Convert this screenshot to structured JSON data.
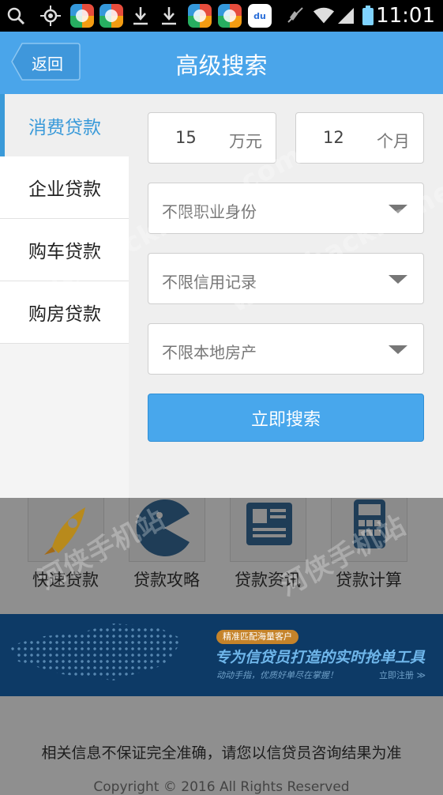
{
  "status_bar": {
    "time": "11:01",
    "icons": [
      "search-icon",
      "locate-icon",
      "app-icon",
      "app-icon",
      "download-icon",
      "download-icon",
      "app-icon",
      "app-icon",
      "baidu-icon",
      "mute-icon",
      "wifi-icon",
      "signal-icon",
      "battery-icon"
    ],
    "baidu_text": "du"
  },
  "header": {
    "back_label": "返回",
    "title": "高级搜索"
  },
  "sidebar": {
    "items": [
      {
        "label": "消费贷款",
        "active": true
      },
      {
        "label": "企业贷款",
        "active": false
      },
      {
        "label": "购车贷款",
        "active": false
      },
      {
        "label": "购房贷款",
        "active": false
      }
    ]
  },
  "form": {
    "amount": {
      "value": "15",
      "unit": "万元"
    },
    "term": {
      "value": "12",
      "unit": "个月"
    },
    "selects": [
      {
        "value": "不限职业身份"
      },
      {
        "value": "不限信用记录"
      },
      {
        "value": "不限本地房产"
      }
    ],
    "search_label": "立即搜索"
  },
  "background_page": {
    "tiles": [
      {
        "label": "快速贷款",
        "icon": "rocket-icon"
      },
      {
        "label": "贷款攻略",
        "icon": "pacman-icon"
      },
      {
        "label": "贷款资讯",
        "icon": "newspaper-icon"
      },
      {
        "label": "贷款计算",
        "icon": "calculator-icon"
      }
    ],
    "banner": {
      "tag": "精准匹配海量客户",
      "title": "专为信贷员打造的实时抢单工具",
      "subtitle": "动动手指，优质好单尽在掌握！",
      "link": "立即注册 ≫"
    },
    "disclaimer": "相关信息不保证完全准确，请您以信贷员咨询结果为准",
    "copyright": "Copyright © 2016 All Rights Reserved"
  },
  "watermarks": {
    "site": "www.hackhome.com",
    "cn": "河侠手机站"
  },
  "colors": {
    "accent": "#4aa5ea",
    "active_tab": "#3a9ad9",
    "banner_bg": "#0d3a66"
  }
}
